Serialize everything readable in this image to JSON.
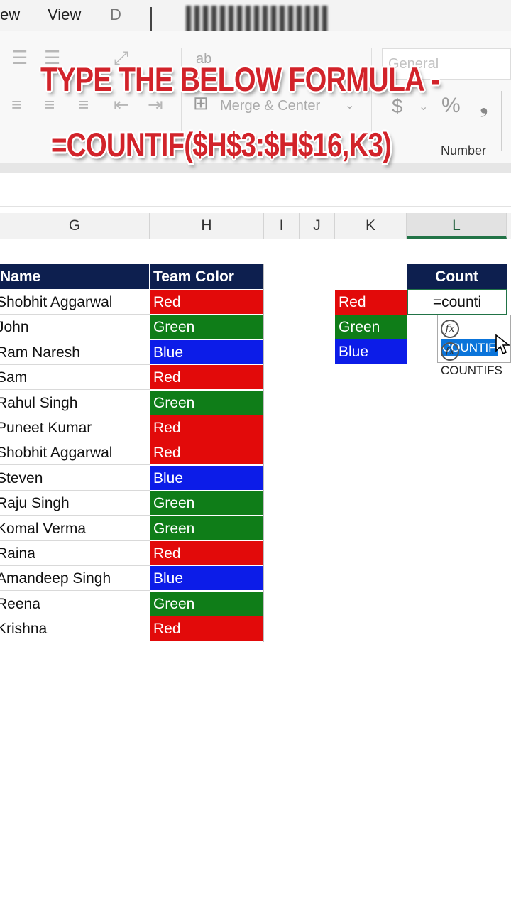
{
  "menubar": {
    "items": [
      "ew",
      "View",
      "D"
    ]
  },
  "ribbon": {
    "wrap_text_label": "ab",
    "merge_center_label": "Merge & Center",
    "number_format_value": "General",
    "currency_symbol": "$",
    "percent_symbol": "%",
    "comma_symbol": "❟",
    "number_group_label": "Number"
  },
  "caption": {
    "line1": "TYPE THE BELOW FORMULA -",
    "line2": "=COUNTIF($H$3:$H$16,K3)"
  },
  "columns": [
    "G",
    "H",
    "I",
    "J",
    "K",
    "L"
  ],
  "table": {
    "headers": [
      "Name",
      "Team Color"
    ],
    "rows": [
      {
        "name": "Shobhit Aggarwal",
        "team": "Red"
      },
      {
        "name": "John",
        "team": "Green"
      },
      {
        "name": "Ram Naresh",
        "team": "Blue"
      },
      {
        "name": "Sam",
        "team": "Red"
      },
      {
        "name": "Rahul Singh",
        "team": "Green"
      },
      {
        "name": "Puneet Kumar",
        "team": "Red"
      },
      {
        "name": "Shobhit Aggarwal",
        "team": "Red"
      },
      {
        "name": "Steven",
        "team": "Blue"
      },
      {
        "name": "Raju Singh",
        "team": "Green"
      },
      {
        "name": "Komal Verma",
        "team": "Green"
      },
      {
        "name": "Raina",
        "team": "Red"
      },
      {
        "name": "Amandeep Singh",
        "team": "Blue"
      },
      {
        "name": "Reena",
        "team": "Green"
      },
      {
        "name": "Krishna",
        "team": "Red"
      }
    ]
  },
  "count_table": {
    "header": "Count",
    "labels": [
      "Red",
      "Green",
      "Blue"
    ],
    "editing_value": "=counti"
  },
  "autocomplete": {
    "items": [
      "COUNTIF",
      "COUNTIFS"
    ],
    "fx_symbol": "fx"
  },
  "colors": {
    "Red": "#e20a0a",
    "Green": "#0f7d18",
    "Blue": "#0c1ce8",
    "header": "#0d1f4f",
    "caption": "#d2232a",
    "selection": "#0a74da"
  }
}
